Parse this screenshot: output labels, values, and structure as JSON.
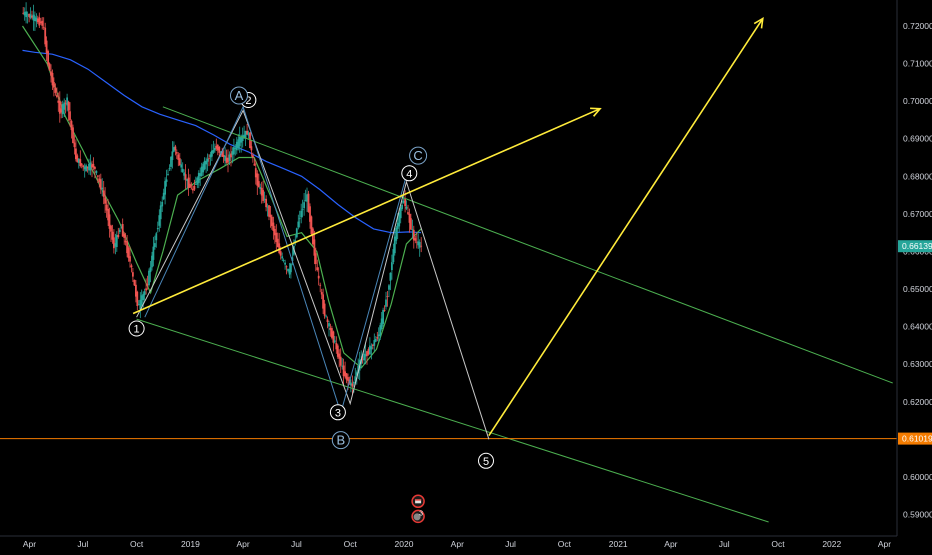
{
  "chart_data": {
    "type": "candlestick",
    "title": "",
    "xlabel": "",
    "ylabel": "",
    "ylim": [
      0.585,
      0.725
    ],
    "grid": false,
    "legend": "none",
    "x_ticks": [
      {
        "label": "Apr",
        "date": "2018-04-01"
      },
      {
        "label": "Jul",
        "date": "2018-07-01"
      },
      {
        "label": "Oct",
        "date": "2018-10-01"
      },
      {
        "label": "2019",
        "date": "2019-01-01"
      },
      {
        "label": "Apr",
        "date": "2019-04-01"
      },
      {
        "label": "Jul",
        "date": "2019-07-01"
      },
      {
        "label": "Oct",
        "date": "2019-10-01"
      },
      {
        "label": "2020",
        "date": "2020-01-01"
      },
      {
        "label": "Apr",
        "date": "2020-04-01"
      },
      {
        "label": "Jul",
        "date": "2020-07-01"
      },
      {
        "label": "Oct",
        "date": "2020-10-01"
      },
      {
        "label": "2021",
        "date": "2021-01-01"
      },
      {
        "label": "Apr",
        "date": "2021-04-01"
      },
      {
        "label": "Jul",
        "date": "2021-07-01"
      },
      {
        "label": "Oct",
        "date": "2021-10-01"
      },
      {
        "label": "2022",
        "date": "2022-01-01"
      },
      {
        "label": "Apr",
        "date": "2022-04-01"
      }
    ],
    "y_ticks": [
      0.72,
      0.71,
      0.7,
      0.69,
      0.68,
      0.67,
      0.66,
      0.65,
      0.64,
      0.63,
      0.62,
      0.61,
      0.6,
      0.59
    ],
    "y_tick_labels": [
      "0.72000",
      "0.71000",
      "0.70000",
      "0.69000",
      "0.68000",
      "0.67000",
      "0.66000",
      "0.65000",
      "0.64000",
      "0.63000",
      "0.62000",
      "0.61000",
      "0.60000",
      "0.59000"
    ],
    "price_labels": [
      {
        "value": 0.66139,
        "text": "0.66139",
        "color": "#26a69a"
      },
      {
        "value": 0.61019,
        "text": "0.61019",
        "color": "#f57c00"
      }
    ],
    "horizontal_line": {
      "value": 0.61019,
      "color": "#f57c00"
    },
    "price_path": [
      [
        "2018-03-20",
        0.7235
      ],
      [
        "2018-04-05",
        0.7225
      ],
      [
        "2018-04-25",
        0.7205
      ],
      [
        "2018-05-05",
        0.709
      ],
      [
        "2018-05-25",
        0.697
      ],
      [
        "2018-06-05",
        0.7005
      ],
      [
        "2018-06-20",
        0.685
      ],
      [
        "2018-07-05",
        0.682
      ],
      [
        "2018-07-20",
        0.683
      ],
      [
        "2018-08-05",
        0.676
      ],
      [
        "2018-08-25",
        0.661
      ],
      [
        "2018-09-05",
        0.667
      ],
      [
        "2018-09-20",
        0.658
      ],
      [
        "2018-10-05",
        0.645
      ],
      [
        "2018-10-20",
        0.651
      ],
      [
        "2018-11-05",
        0.665
      ],
      [
        "2018-11-20",
        0.678
      ],
      [
        "2018-12-05",
        0.688
      ],
      [
        "2018-12-20",
        0.681
      ],
      [
        "2019-01-05",
        0.676
      ],
      [
        "2019-01-25",
        0.683
      ],
      [
        "2019-02-15",
        0.688
      ],
      [
        "2019-03-05",
        0.684
      ],
      [
        "2019-03-25",
        0.689
      ],
      [
        "2019-04-10",
        0.692
      ],
      [
        "2019-04-25",
        0.679
      ],
      [
        "2019-05-15",
        0.671
      ],
      [
        "2019-06-05",
        0.659
      ],
      [
        "2019-06-20",
        0.654
      ],
      [
        "2019-07-05",
        0.668
      ],
      [
        "2019-07-20",
        0.675
      ],
      [
        "2019-08-05",
        0.656
      ],
      [
        "2019-08-20",
        0.643
      ],
      [
        "2019-09-05",
        0.636
      ],
      [
        "2019-09-20",
        0.628
      ],
      [
        "2019-10-05",
        0.624
      ],
      [
        "2019-10-20",
        0.631
      ],
      [
        "2019-11-05",
        0.634
      ],
      [
        "2019-11-20",
        0.638
      ],
      [
        "2019-12-05",
        0.649
      ],
      [
        "2019-12-20",
        0.666
      ],
      [
        "2020-01-01",
        0.674
      ],
      [
        "2020-01-10",
        0.669
      ],
      [
        "2020-01-20",
        0.663
      ],
      [
        "2020-01-30",
        0.6614
      ]
    ],
    "moving_averages": [
      {
        "color": "#2962ff",
        "points": [
          [
            "2018-03-20",
            0.7135
          ],
          [
            "2018-04-10",
            0.713
          ],
          [
            "2018-05-10",
            0.7125
          ],
          [
            "2018-06-10",
            0.711
          ],
          [
            "2018-07-10",
            0.7085
          ],
          [
            "2018-08-10",
            0.705
          ],
          [
            "2018-09-10",
            0.7015
          ],
          [
            "2018-10-10",
            0.6985
          ],
          [
            "2018-11-10",
            0.6965
          ],
          [
            "2018-12-10",
            0.695
          ],
          [
            "2019-01-10",
            0.6935
          ],
          [
            "2019-02-10",
            0.691
          ],
          [
            "2019-03-10",
            0.6885
          ],
          [
            "2019-04-10",
            0.6865
          ],
          [
            "2019-05-10",
            0.684
          ],
          [
            "2019-06-10",
            0.682
          ],
          [
            "2019-07-10",
            0.68
          ],
          [
            "2019-08-10",
            0.6765
          ],
          [
            "2019-09-10",
            0.6725
          ],
          [
            "2019-10-10",
            0.669
          ],
          [
            "2019-11-10",
            0.666
          ],
          [
            "2019-12-10",
            0.665
          ],
          [
            "2020-01-10",
            0.6652
          ],
          [
            "2020-01-30",
            0.665
          ]
        ]
      },
      {
        "color": "#4caf50",
        "points": [
          [
            "2018-03-20",
            0.72
          ],
          [
            "2018-05-01",
            0.71
          ],
          [
            "2018-06-01",
            0.696
          ],
          [
            "2018-07-01",
            0.687
          ],
          [
            "2018-08-01",
            0.677
          ],
          [
            "2018-09-01",
            0.668
          ],
          [
            "2018-10-01",
            0.657
          ],
          [
            "2018-10-25",
            0.649
          ],
          [
            "2018-11-15",
            0.66
          ],
          [
            "2018-12-10",
            0.675
          ],
          [
            "2019-01-15",
            0.679
          ],
          [
            "2019-02-20",
            0.682
          ],
          [
            "2019-03-25",
            0.685
          ],
          [
            "2019-04-20",
            0.685
          ],
          [
            "2019-05-20",
            0.674
          ],
          [
            "2019-06-15",
            0.664
          ],
          [
            "2019-07-10",
            0.665
          ],
          [
            "2019-08-05",
            0.66
          ],
          [
            "2019-08-25",
            0.647
          ],
          [
            "2019-09-20",
            0.633
          ],
          [
            "2019-10-20",
            0.629
          ],
          [
            "2019-11-15",
            0.634
          ],
          [
            "2019-12-10",
            0.646
          ],
          [
            "2020-01-05",
            0.662
          ],
          [
            "2020-01-30",
            0.666
          ]
        ]
      }
    ],
    "channel_lines": [
      {
        "color": "#4caf50",
        "points": [
          [
            "2018-11-15",
            0.6985
          ],
          [
            "2022-04-15",
            0.625
          ]
        ]
      },
      {
        "color": "#4caf50",
        "points": [
          [
            "2018-10-01",
            0.642
          ],
          [
            "2021-09-15",
            0.588
          ]
        ]
      }
    ],
    "trend_arrows": [
      {
        "color": "#ffeb3b",
        "points": [
          [
            "2018-09-25",
            0.6435
          ],
          [
            "2020-12-01",
            0.698
          ]
        ]
      },
      {
        "color": "#ffeb3b",
        "points": [
          [
            "2020-05-25",
            0.611
          ],
          [
            "2021-09-05",
            0.722
          ]
        ]
      }
    ],
    "wave_paths": [
      {
        "color": "#c8c8c8",
        "points": [
          [
            "2018-10-01",
            0.6425
          ],
          [
            "2019-04-01",
            0.6975
          ],
          [
            "2019-10-01",
            0.6195
          ],
          [
            "2020-01-05",
            0.6785
          ],
          [
            "2020-05-25",
            0.61
          ]
        ]
      },
      {
        "color": "#4a86b8",
        "points": [
          [
            "2018-10-15",
            0.6425
          ],
          [
            "2019-04-01",
            0.6985
          ],
          [
            "2019-09-15",
            0.617
          ],
          [
            "2020-01-10",
            0.683
          ]
        ]
      }
    ],
    "wave_labels": [
      {
        "text": "1",
        "date": "2018-10-01",
        "value": 0.6395,
        "style": "white"
      },
      {
        "text": "2",
        "date": "2019-04-10",
        "value": 0.7003,
        "style": "white"
      },
      {
        "text": "3",
        "date": "2019-09-10",
        "value": 0.6172,
        "style": "white"
      },
      {
        "text": "4",
        "date": "2020-01-10",
        "value": 0.6808,
        "style": "white"
      },
      {
        "text": "5",
        "date": "2020-05-20",
        "value": 0.6043,
        "style": "white"
      },
      {
        "text": "A",
        "date": "2019-03-25",
        "value": 0.7015,
        "style": "blue"
      },
      {
        "text": "B",
        "date": "2019-09-15",
        "value": 0.6098,
        "style": "blue"
      },
      {
        "text": "C",
        "date": "2020-01-25",
        "value": 0.6855,
        "style": "blue"
      }
    ],
    "event_markers": [
      {
        "date": "2020-01-25",
        "value": 0.5935,
        "kind": "flag"
      },
      {
        "date": "2020-01-25",
        "value": 0.5895,
        "kind": "badge",
        "text": "3"
      }
    ]
  }
}
